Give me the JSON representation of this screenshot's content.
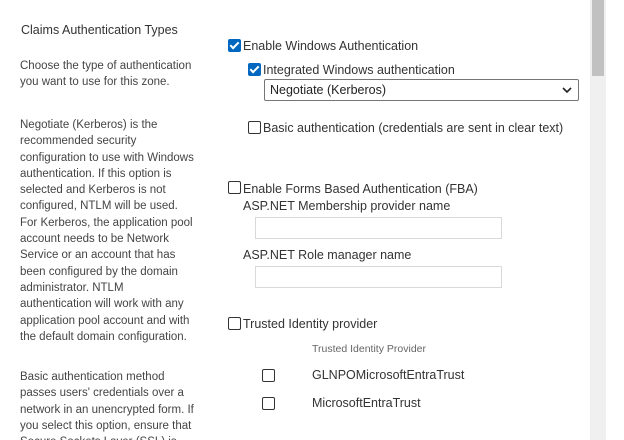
{
  "section": {
    "title": "Claims Authentication Types",
    "desc_1": "Choose the type of authentication you want to use for this zone.",
    "desc_2": "Negotiate (Kerberos) is the recommended security configuration to use with Windows authentication. If this option is selected and Kerberos is not configured, NTLM will be used. For Kerberos, the application pool account needs to be Network Service or an account that has been configured by the domain administrator. NTLM authentication will work with any application pool account and with the default domain configuration.",
    "desc_3": "Basic authentication method passes users' credentials over a network in an unencrypted form. If you select this option, ensure that Secure Sockets Layer (SSL) is"
  },
  "windows_auth": {
    "label": "Enable Windows Authentication",
    "checked": true,
    "integrated": {
      "label": "Integrated Windows authentication",
      "checked": true
    },
    "integrated_select": {
      "value": "Negotiate (Kerberos)"
    },
    "basic": {
      "label": "Basic authentication (credentials are sent in clear text)",
      "checked": false
    }
  },
  "forms_auth": {
    "label": "Enable Forms Based Authentication (FBA)",
    "checked": false,
    "membership_label": "ASP.NET Membership provider name",
    "membership_value": "",
    "role_label": "ASP.NET Role manager name",
    "role_value": ""
  },
  "trusted": {
    "label": "Trusted Identity provider",
    "checked": false,
    "column_header": "Trusted Identity Provider",
    "providers": [
      {
        "name": "GLNPOMicrosoftEntraTrust",
        "checked": false
      },
      {
        "name": "MicrosoftEntraTrust",
        "checked": false
      }
    ]
  },
  "colors": {
    "accent": "#0067c0",
    "text": "#333333",
    "muted": "#666666"
  }
}
